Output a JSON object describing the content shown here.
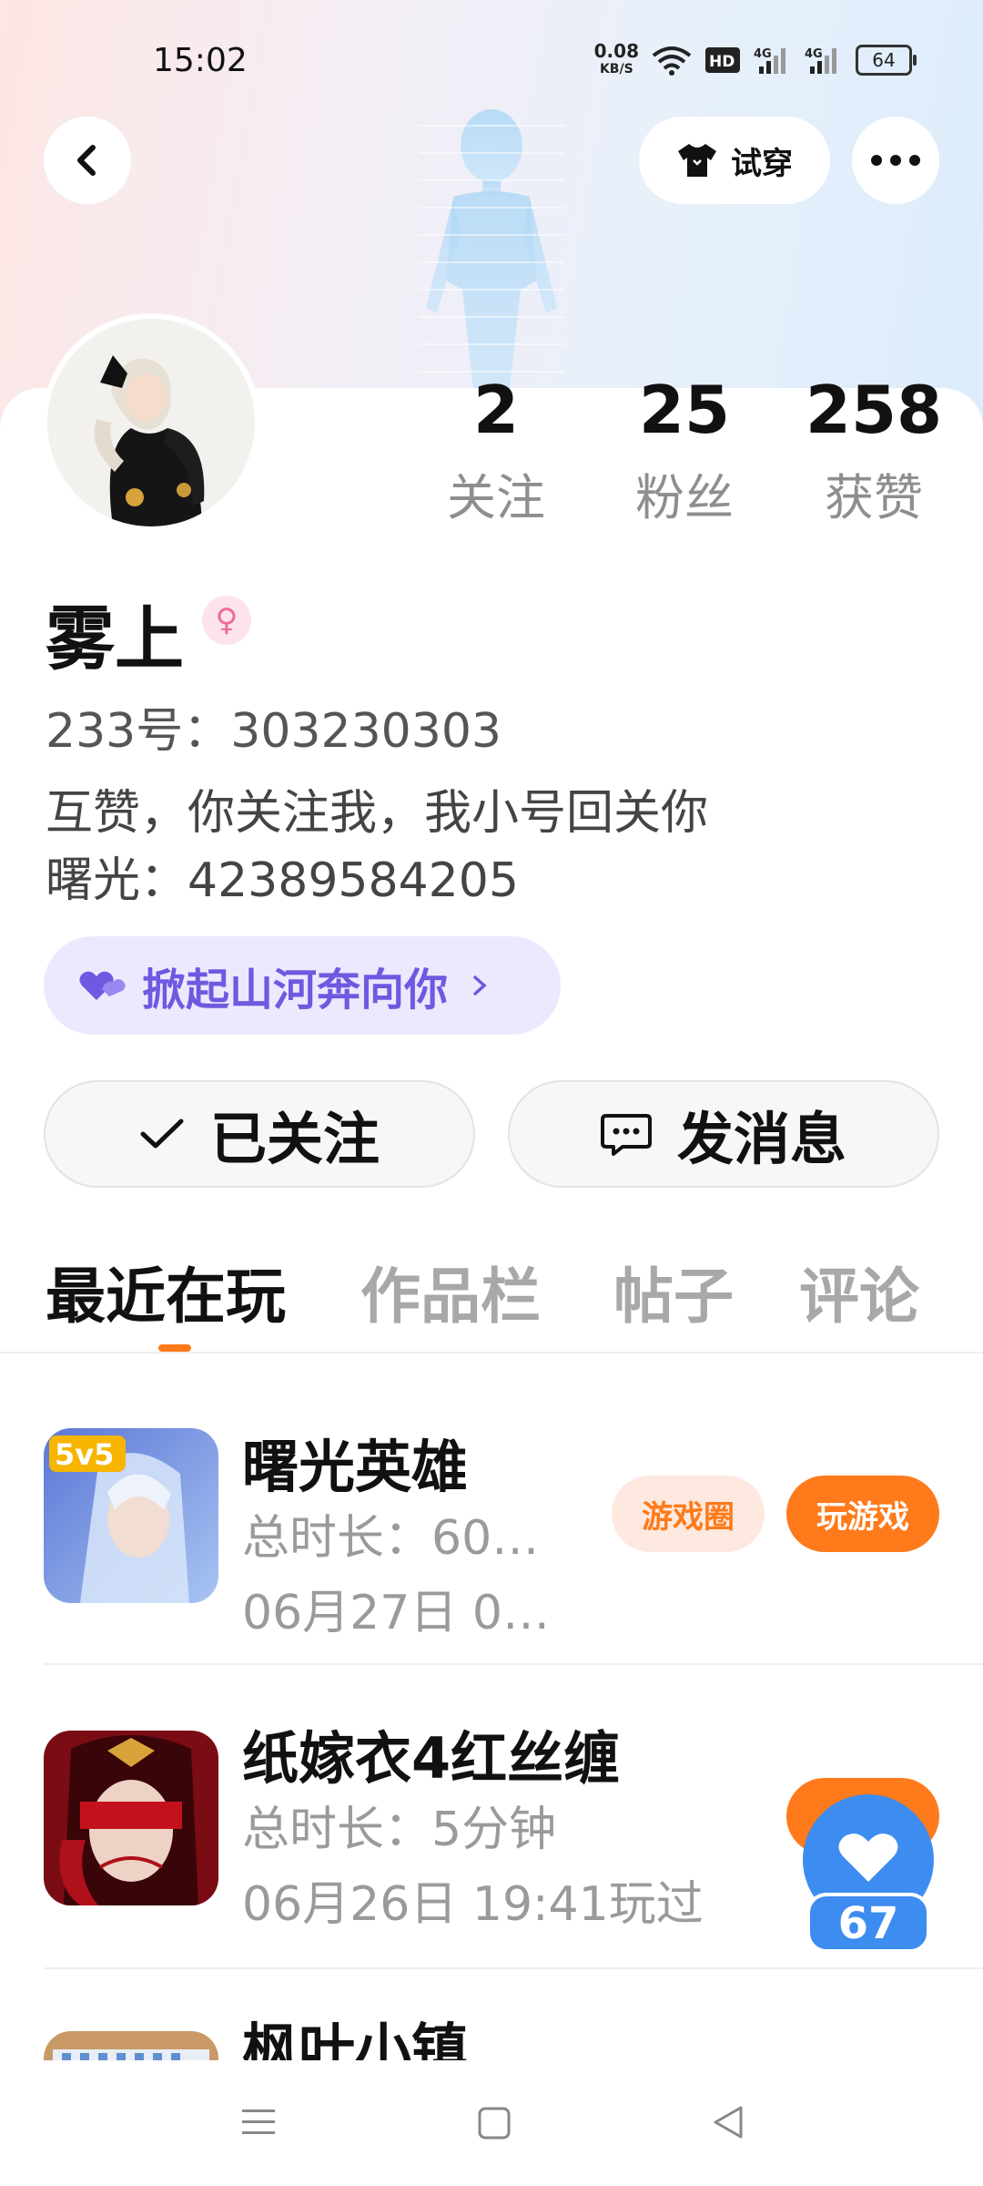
{
  "status_bar": {
    "time": "15:02",
    "net_speed_value": "0.08",
    "net_speed_unit": "KB/S",
    "battery": "64",
    "icons": [
      "wifi-icon",
      "hd-icon",
      "signal-4g-icon",
      "signal-4g-icon",
      "battery-icon"
    ]
  },
  "header": {
    "back_icon": "chevron-left-icon",
    "tryon_label": "试穿",
    "more_icon": "more-dots-icon"
  },
  "stats": [
    {
      "value": "2",
      "label": "关注"
    },
    {
      "value": "25",
      "label": "粉丝"
    },
    {
      "value": "258",
      "label": "获赞"
    }
  ],
  "profile": {
    "nickname": "雾上",
    "gender_icon": "female-icon",
    "id_line": "233号：303230303",
    "bio_line1": "互赞，你关注我，我小号回关你",
    "bio_line2": "曙光：42389584205",
    "tag_text": "掀起山河奔向你"
  },
  "actions": {
    "followed_label": "已关注",
    "message_label": "发消息"
  },
  "tabs": [
    "最近在玩",
    "作品栏",
    "帖子",
    "评论"
  ],
  "games": [
    {
      "title": "曙光英雄",
      "duration": "总时长：60…",
      "last_played": "06月27日 0…",
      "circle_btn": "游戏圈",
      "play_btn": "玩游戏",
      "badge": "5v5"
    },
    {
      "title": "纸嫁衣4红丝缠",
      "duration": "总时长：5分钟",
      "last_played": "06月26日 19:41玩过"
    },
    {
      "title": "枫叶小镇"
    }
  ],
  "like_float": {
    "count": "67"
  },
  "colors": {
    "accent_orange": "#ff7a1a",
    "circle_btn_bg": "#fde9df",
    "tag_purple": "#7058e0",
    "like_blue": "#3d8cf0"
  }
}
